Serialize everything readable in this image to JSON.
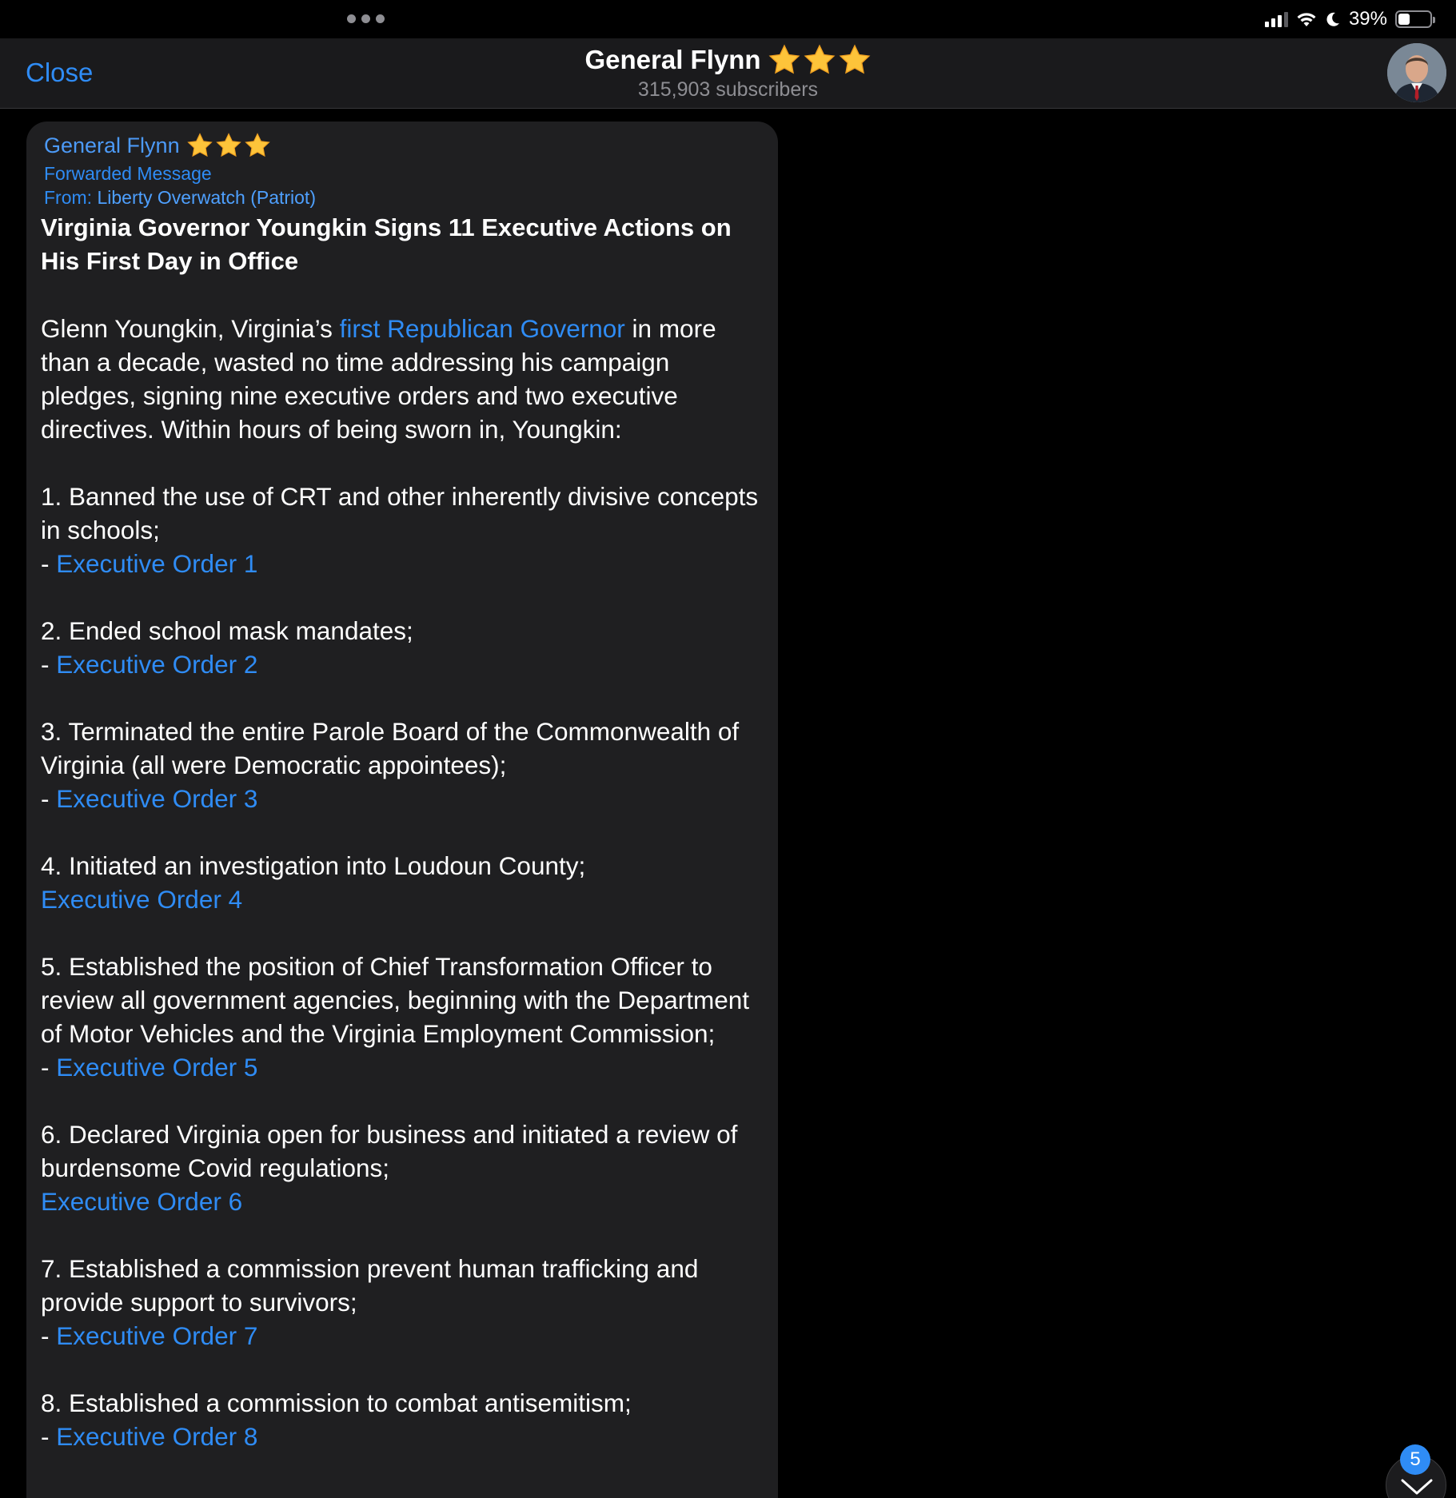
{
  "status_bar": {
    "battery_text": "39%",
    "battery_level": 0.39,
    "icons": [
      "cellular-signal-icon",
      "wifi-icon",
      "moon-icon",
      "battery-icon"
    ]
  },
  "top_dots": "more-dots-icon",
  "nav": {
    "close_label": "Close",
    "title": "General Flynn",
    "title_stars": 3,
    "subtitle": "315,903 subscribers"
  },
  "message": {
    "sender": "General Flynn",
    "sender_stars": 3,
    "forwarded_label": "Forwarded Message",
    "from_prefix": "From: ",
    "from_source": "Liberty Overwatch (Patriot)",
    "headline": "Virginia Governor Youngkin Signs 11 Executive Actions on His First Day in Office",
    "intro_before_link": "Glenn Youngkin, Virginia’s ",
    "intro_link": "first Republican Governor",
    "intro_after_link": " in more than a decade, wasted no time addressing his campaign pledges, signing nine executive orders and two executive directives. Within hours of being sworn in, Youngkin:",
    "items": [
      {
        "text": "1. Banned the use of CRT and other inherently divisive concepts in schools;",
        "prefix": "- ",
        "link": "Executive Order 1"
      },
      {
        "text": "2. Ended school mask mandates;",
        "prefix": "- ",
        "link": "Executive Order 2"
      },
      {
        "text": "3. Terminated the entire Parole Board of the Commonwealth of Virginia (all were Democratic appointees);",
        "prefix": "- ",
        "link": "Executive Order 3"
      },
      {
        "text": "4. Initiated an investigation into Loudoun County;",
        "prefix": "",
        "link": "Executive Order 4"
      },
      {
        "text": "5. Established the position of Chief Transformation Officer to review all government agencies, beginning with the Department of Motor Vehicles and the Virginia Employment Commission;",
        "prefix": "- ",
        "link": "Executive Order 5"
      },
      {
        "text": "6. Declared Virginia open for business and initiated a review of burdensome Covid regulations;",
        "prefix": "",
        "link": "Executive Order 6"
      },
      {
        "text": "7. Established a commission prevent human trafficking and provide support to survivors;",
        "prefix": "- ",
        "link": "Executive Order 7"
      },
      {
        "text": "8. Established a commission to combat antisemitism;",
        "prefix": "- ",
        "link": "Executive Order 8"
      }
    ]
  },
  "scroll_button": {
    "icon": "chevron-down-icon",
    "badge": "5"
  },
  "colors": {
    "accent": "#2f8cf5",
    "background": "#000000",
    "bubble": "#1f1f21",
    "navbar": "#1a1a1c"
  }
}
